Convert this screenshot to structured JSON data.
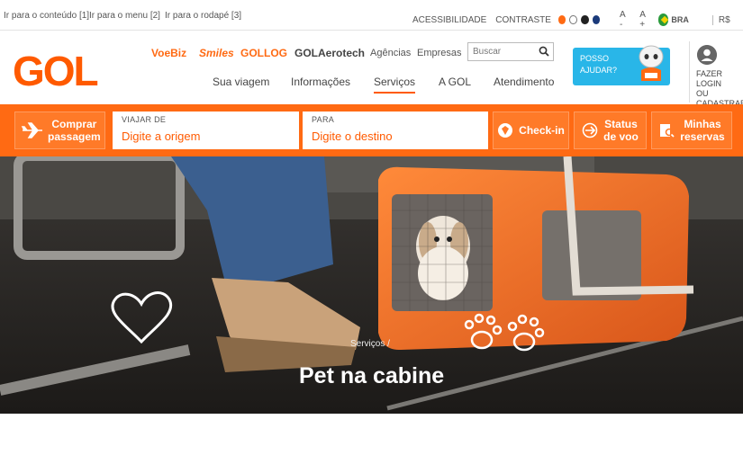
{
  "skip_links": [
    "Ir para o conteúdo [1]",
    "Ir para o menu [2]",
    "Ir para o rodapé [3]"
  ],
  "utility": {
    "accessibility": "ACESSIBILIDADE",
    "contrast": "CONTRASTE",
    "contrast_colors": [
      "#ff6a13",
      "#ffffff",
      "#222222",
      "#1b3a7a"
    ],
    "font_decrease": "A -",
    "font_increase": "A +",
    "country": "BRA",
    "currency": "R$",
    "help": "?"
  },
  "header": {
    "logo": "GOL",
    "brands": [
      "VoeBiz",
      "Smiles",
      "GOLLOG",
      "GOLAerotech"
    ],
    "links": [
      "Agências",
      "Empresas"
    ],
    "search_placeholder": "Buscar",
    "nav": [
      "Sua viagem",
      "Informações",
      "Serviços",
      "A GOL",
      "Atendimento"
    ],
    "active_nav": "Serviços",
    "help_box_line1": "POSSO",
    "help_box_line2": "AJUDAR?",
    "login_line1": "FAZER LOGIN",
    "login_line2": "OU CADASTRAR"
  },
  "booking": {
    "buy_line1": "Comprar",
    "buy_line2": "passagem",
    "from_label": "VIAJAR DE",
    "from_placeholder": "Digite a origem",
    "to_label": "PARA",
    "to_placeholder": "Digite o destino",
    "checkin": "Check-in",
    "status_line1": "Status",
    "status_line2": "de voo",
    "reservations_line1": "Minhas",
    "reservations_line2": "reservas"
  },
  "hero": {
    "breadcrumb": "Serviços /",
    "title": "Pet na cabine"
  },
  "colors": {
    "brand_orange": "#ff6a13",
    "help_blue": "#29b6e8"
  }
}
